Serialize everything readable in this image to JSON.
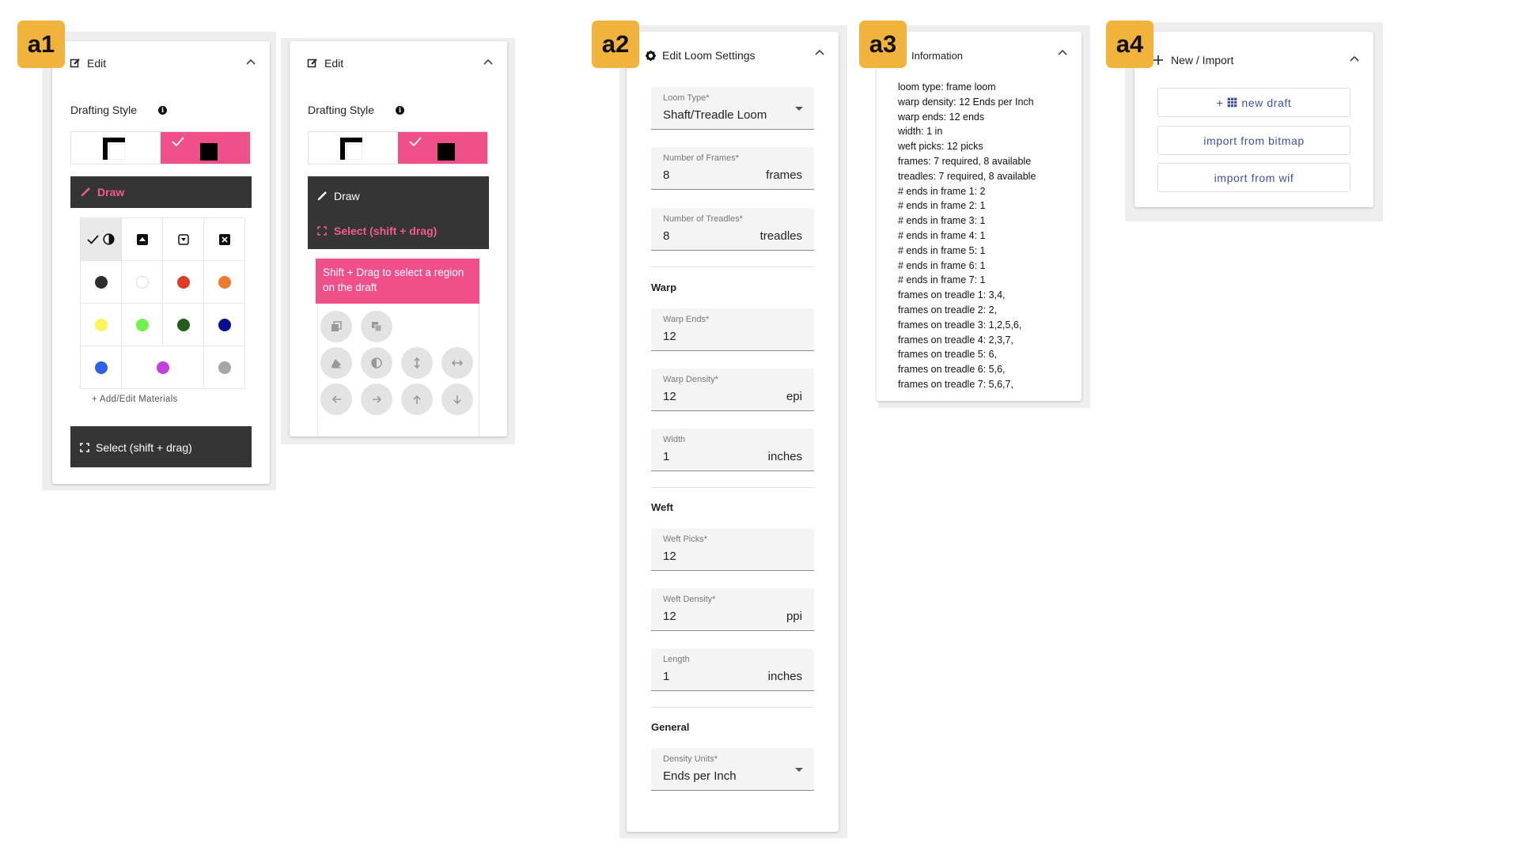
{
  "panels": {
    "a1": {
      "badge": "a1",
      "header_title": "Edit",
      "drafting_style_label": "Drafting Style",
      "draw_label": "Draw",
      "add_materials_label": "+ Add/Edit Materials",
      "select_label": "Select (shift + drag)",
      "material_colors": [
        "#2f2f2f",
        "#ffffff",
        "#e23b2a",
        "#ee7a2e",
        "#fbf55c",
        "#6ef24f",
        "#245e1d",
        "#0a0f8e",
        "#2d62e8",
        "#c43fe0",
        "#a6a6a6"
      ]
    },
    "a1b": {
      "header_title": "Edit",
      "drafting_style_label": "Drafting Style",
      "draw_label": "Draw",
      "select_label": "Select (shift + drag)",
      "tooltip": "Shift + Drag to select a region on the draft"
    },
    "a2": {
      "badge": "a2",
      "header_title": "Edit Loom Settings",
      "loom_type": {
        "label": "Loom Type*",
        "value": "Shaft/Treadle Loom"
      },
      "frames": {
        "label": "Number of Frames*",
        "value": "8",
        "unit": "frames"
      },
      "treadles": {
        "label": "Number of Treadles*",
        "value": "8",
        "unit": "treadles"
      },
      "warp_section": "Warp",
      "warp_ends": {
        "label": "Warp Ends*",
        "value": "12"
      },
      "warp_density": {
        "label": "Warp Density*",
        "value": "12",
        "unit": "epi"
      },
      "width": {
        "label": "Width",
        "value": "1",
        "unit": "inches"
      },
      "weft_section": "Weft",
      "weft_picks": {
        "label": "Weft Picks*",
        "value": "12"
      },
      "weft_density": {
        "label": "Weft Density*",
        "value": "12",
        "unit": "ppi"
      },
      "length": {
        "label": "Length",
        "value": "1",
        "unit": "inches"
      },
      "general_section": "General",
      "density_units": {
        "label": "Density Units*",
        "value": "Ends per Inch"
      }
    },
    "a3": {
      "badge": "a3",
      "header_title": "Information",
      "lines": [
        "loom type: frame loom",
        "warp density: 12 Ends per Inch",
        "warp ends: 12 ends",
        "width: 1 in",
        "weft picks: 12 picks",
        "frames: 7 required, 8 available",
        "treadles: 7 required, 8 available",
        "# ends in frame 1: 2",
        "# ends in frame 2: 1",
        "# ends in frame 3: 1",
        "# ends in frame 4: 1",
        "# ends in frame 5: 1",
        "# ends in frame 6: 1",
        "# ends in frame 7: 1",
        "frames on treadle 1: 3,4,",
        "frames on treadle 2: 2,",
        "frames on treadle 3: 1,2,5,6,",
        "frames on treadle 4: 2,3,7,",
        "frames on treadle 5: 6,",
        "frames on treadle 6: 5,6,",
        "frames on treadle 7: 5,6,7,"
      ]
    },
    "a4": {
      "badge": "a4",
      "header_title": "New / Import",
      "new_draft": "new draft",
      "new_draft_prefix": "+",
      "import_bitmap": "import from bitmap",
      "import_wif": "import from wif"
    }
  },
  "colors": {
    "accent_pink": "#ef5089",
    "dark": "#353535",
    "badge": "#f2b33d",
    "link_blue": "#3f4fa6"
  }
}
